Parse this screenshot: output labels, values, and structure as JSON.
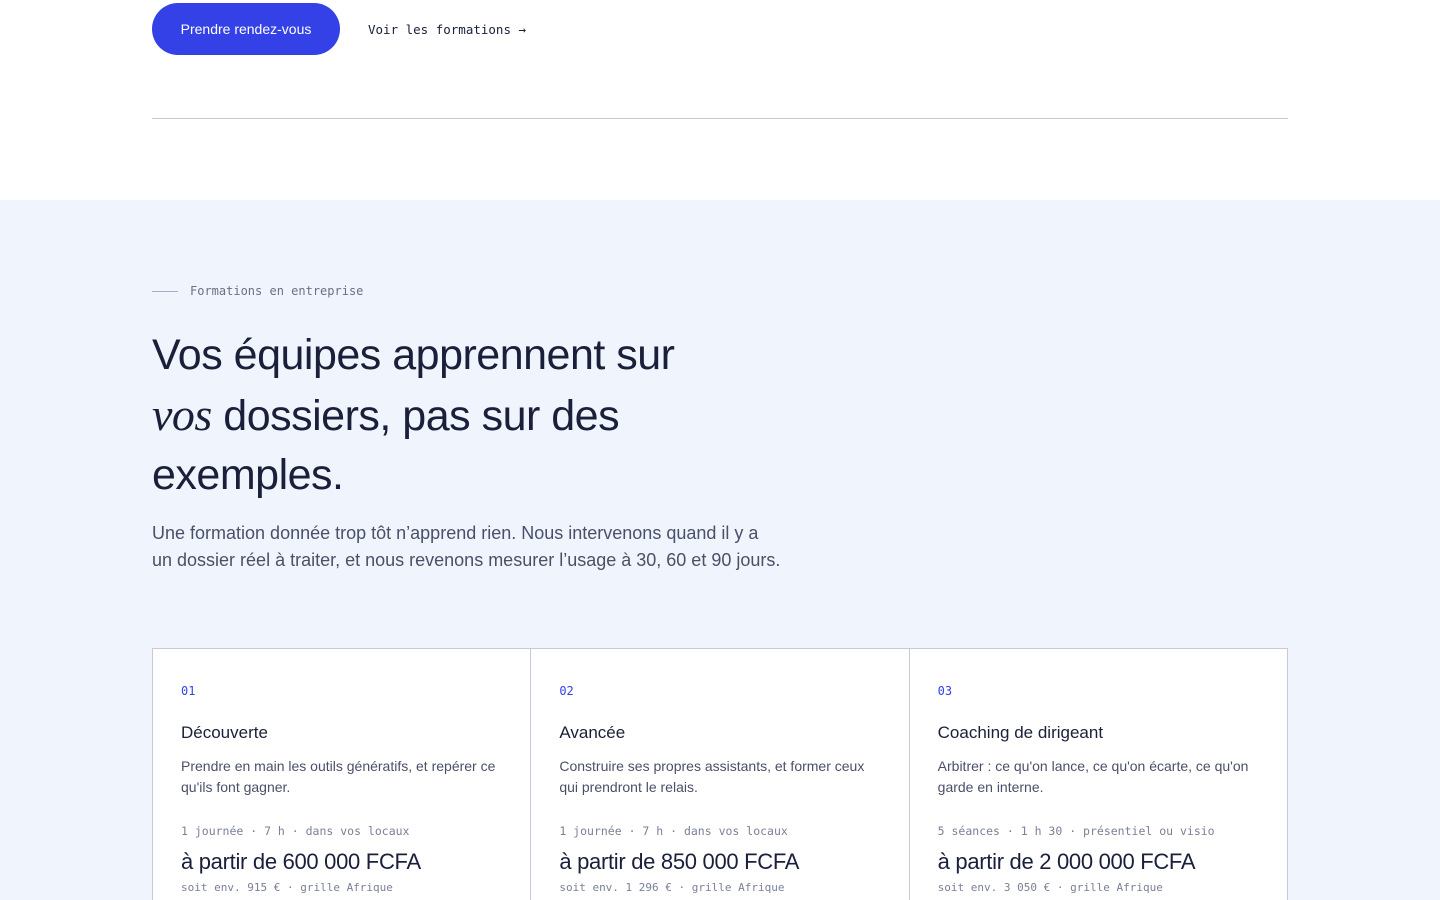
{
  "hero": {
    "primary_button": "Prendre rendez-vous",
    "secondary_link": "Voir les formations →"
  },
  "section": {
    "eyebrow": "Formations en entreprise",
    "headline": {
      "part1": "Vos équipes apprennent sur",
      "emphasis": "vos",
      "part2": "dossiers, pas sur des exemples."
    },
    "lede": "Une formation donnée trop tôt n’apprend rien. Nous intervenons quand il y a un dossier réel à traiter, et nous revenons mesurer l’usage à 30, 60 et 90 jours."
  },
  "cards": [
    {
      "num": "01",
      "title": "Découverte",
      "desc": "Prendre en main les outils génératifs, et repérer ce qu'ils font gagner.",
      "meta": "1 journée · 7 h · dans vos locaux",
      "price": "à partir de 600 000 FCFA",
      "equiv": "soit env. 915 € · grille Afrique"
    },
    {
      "num": "02",
      "title": "Avancée",
      "desc": "Construire ses propres assistants, et former ceux qui prendront le relais.",
      "meta": "1 journée · 7 h · dans vos locaux",
      "price": "à partir de 850 000 FCFA",
      "equiv": "soit env. 1 296 € · grille Afrique"
    },
    {
      "num": "03",
      "title": "Coaching de dirigeant",
      "desc": "Arbitrer : ce qu'on lance, ce qu'on écarte, ce qu'on garde en interne.",
      "meta": "5 séances · 1 h 30 · présentiel ou visio",
      "price": "à partir de 2 000 000 FCFA",
      "equiv": "soit env. 3 050 € · grille Afrique"
    }
  ]
}
